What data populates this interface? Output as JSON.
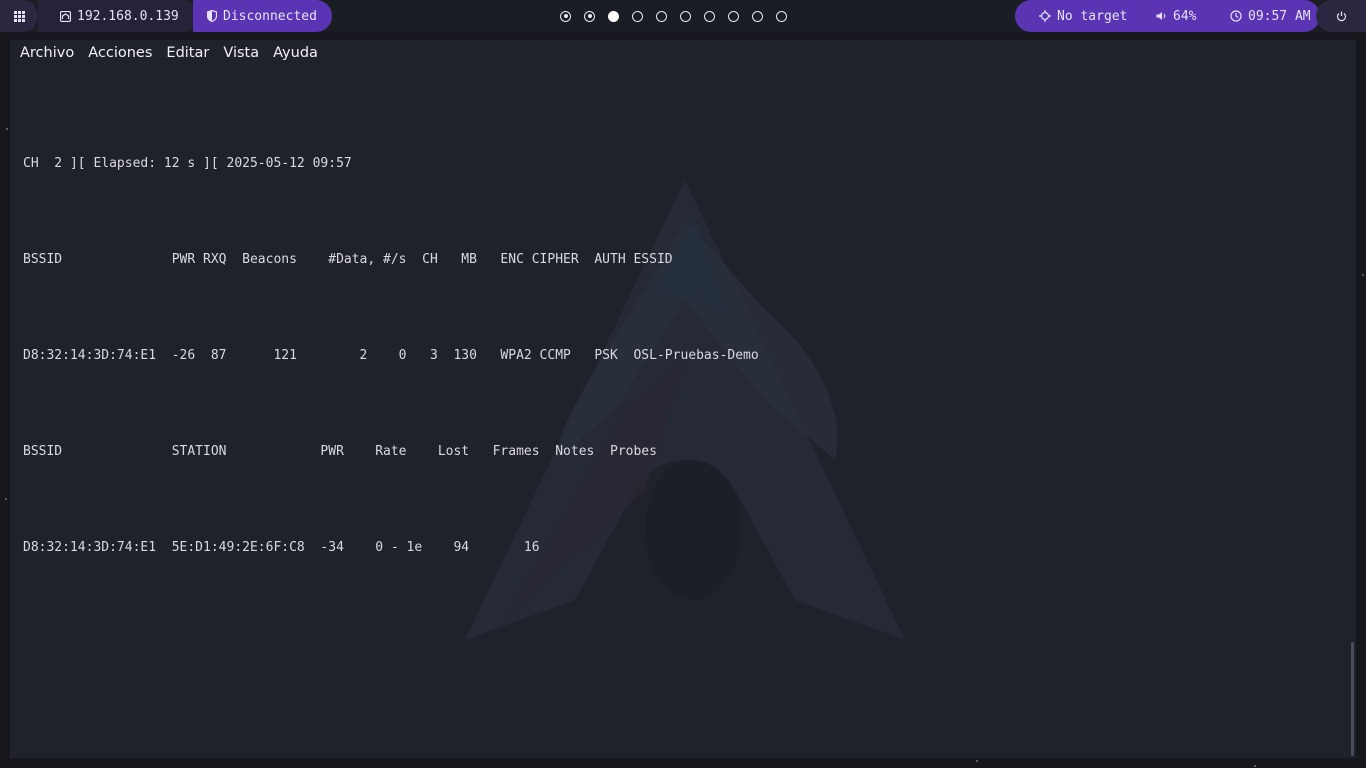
{
  "topbar": {
    "menu_icon": "grid-icon",
    "ip_icon": "network-icon",
    "ip": "192.168.0.139",
    "vpn_icon": "shield-icon",
    "vpn_status": "Disconnected",
    "workspaces": [
      "dot",
      "dot",
      "active",
      "empty",
      "empty",
      "empty",
      "empty",
      "empty",
      "empty",
      "empty"
    ],
    "target_icon": "crosshair-icon",
    "target": "No target",
    "volume_icon": "speaker-icon",
    "volume": "64%",
    "clock_icon": "clock-icon",
    "time": "09:57 AM",
    "power_icon": "power-icon"
  },
  "menu": {
    "archivo": "Archivo",
    "acciones": "Acciones",
    "editar": "Editar",
    "vista": "Vista",
    "ayuda": "Ayuda"
  },
  "terminal": {
    "lines": [
      "CH  2 ][ Elapsed: 12 s ][ 2025-05-12 09:57",
      "BSSID              PWR RXQ  Beacons    #Data, #/s  CH   MB   ENC CIPHER  AUTH ESSID",
      "D8:32:14:3D:74:E1  -26  87      121        2    0   3  130   WPA2 CCMP   PSK  OSL-Pruebas-Demo",
      "BSSID              STATION            PWR    Rate    Lost   Frames  Notes  Probes",
      "D8:32:14:3D:74:E1  5E:D1:49:2E:6F:C8  -34    0 - 1e    94       16"
    ]
  },
  "colors": {
    "accent": "#5a34b3",
    "terminal_bg": "#20222b",
    "desktop_bg": "#15171d",
    "text": "#d9d9df"
  }
}
